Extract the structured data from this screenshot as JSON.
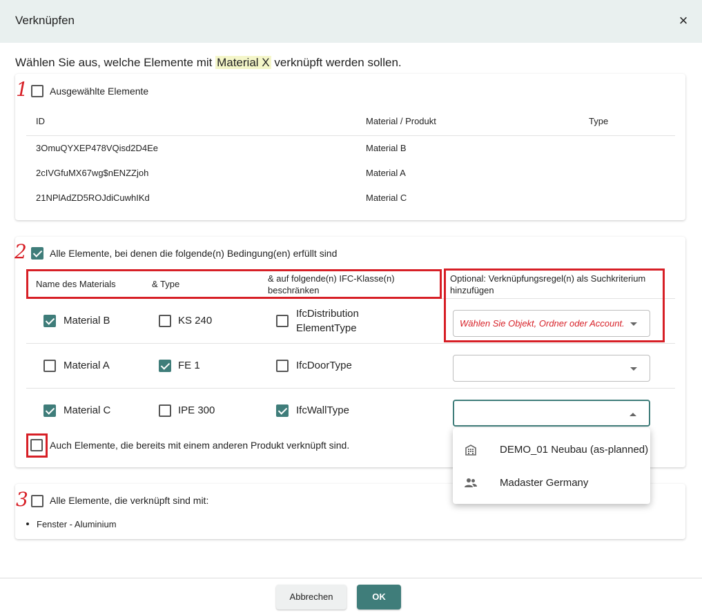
{
  "dialog": {
    "title": "Verknüpfen",
    "close_label": "×"
  },
  "intro": {
    "prefix": "Wählen Sie aus, welche Elemente mit ",
    "material": "Material X",
    "suffix": " verknüpft werden sollen."
  },
  "markers": [
    "1",
    "2",
    "3"
  ],
  "section1": {
    "label": "Ausgewählte Elemente",
    "checked": false,
    "columns": [
      "ID",
      "Material / Produkt",
      "Type"
    ],
    "rows": [
      {
        "id": "3OmuQYXEP478VQisd2D4Ee",
        "material": "Material B",
        "type": ""
      },
      {
        "id": "2cIVGfuMX67wg$nENZZjoh",
        "material": "Material A",
        "type": ""
      },
      {
        "id": "21NPlAdZD5ROJdiCuwhIKd",
        "material": "Material C",
        "type": ""
      }
    ]
  },
  "section2": {
    "label": "Alle Elemente, bei denen die folgende(n) Bedingung(en) erfüllt sind",
    "checked": true,
    "columns": {
      "material": "Name des Materials",
      "type": "& Type",
      "ifc_line1": "& auf folgende(n) IFC-Klasse(n)",
      "ifc_line2": "beschränken",
      "rule_line1": "Optional: Verknüpfungsregel(n) als Suchkriterium",
      "rule_line2": "hinzufügen"
    },
    "rows": [
      {
        "material": "Material B",
        "material_checked": true,
        "type": "KS 240",
        "type_checked": false,
        "ifc_line1": "IfcDistribution",
        "ifc_line2": "ElementType",
        "ifc_checked": false,
        "rule_placeholder": "Wählen Sie Objekt, Ordner oder Account.",
        "rule_value": ""
      },
      {
        "material": "Material A",
        "material_checked": false,
        "type": "FE 1",
        "type_checked": true,
        "ifc_line1": "IfcDoorType",
        "ifc_line2": "",
        "ifc_checked": false,
        "rule_placeholder": "",
        "rule_value": ""
      },
      {
        "material": "Material C",
        "material_checked": true,
        "type": "IPE 300",
        "type_checked": false,
        "ifc_line1": "IfcWallType",
        "ifc_line2": "",
        "ifc_checked": true,
        "rule_placeholder": "",
        "rule_value": ""
      }
    ],
    "also_linked_label": "Auch Elemente, die bereits mit einem anderen Produkt verknüpft sind.",
    "also_linked_checked": false
  },
  "dropdown": {
    "options": [
      {
        "icon": "building-icon",
        "label": "DEMO_01 Neubau (as-planned)"
      },
      {
        "icon": "people-icon",
        "label": "Madaster Germany"
      }
    ]
  },
  "section3": {
    "label": "Alle Elemente, die verknüpft sind mit:",
    "checked": false,
    "items": [
      "Fenster - Aluminium"
    ]
  },
  "footer": {
    "cancel_label": "Abbrechen",
    "ok_label": "OK"
  },
  "colors": {
    "accent": "#3f7d7a",
    "header_bg": "#e9f0ef",
    "annotation_red": "#d71f26",
    "highlight": "#f4f6c9"
  }
}
